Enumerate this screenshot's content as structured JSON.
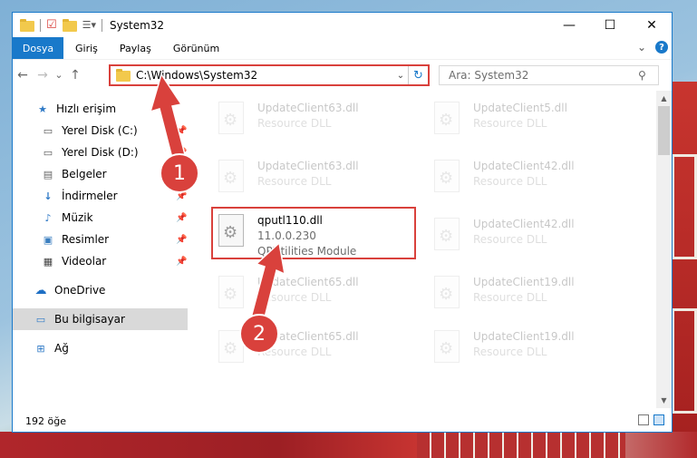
{
  "window": {
    "title": "System32",
    "minimize_glyph": "—",
    "maximize_glyph": "☐",
    "close_glyph": "✕"
  },
  "menu": {
    "file": "Dosya",
    "items": [
      "Giriş",
      "Paylaş",
      "Görünüm"
    ],
    "expand_glyph": "⌄",
    "help_glyph": "?"
  },
  "nav": {
    "back": "←",
    "forward": "→",
    "recent": "⌄",
    "up": "↑",
    "address": "C:\\Windows\\System32",
    "search_placeholder": "Ara: System32"
  },
  "sidebar": {
    "items": [
      {
        "label": "Hızlı erişim",
        "icon": "star-icon",
        "pinned": false
      },
      {
        "label": "Yerel Disk (C:)",
        "icon": "drive-icon",
        "pinned": true
      },
      {
        "label": "Yerel Disk (D:)",
        "icon": "drive-icon",
        "pinned": true
      },
      {
        "label": "Belgeler",
        "icon": "document-icon",
        "pinned": true
      },
      {
        "label": "İndirmeler",
        "icon": "download-icon",
        "pinned": true
      },
      {
        "label": "Müzik",
        "icon": "music-icon",
        "pinned": true
      },
      {
        "label": "Resimler",
        "icon": "picture-icon",
        "pinned": true
      },
      {
        "label": "Videolar",
        "icon": "video-icon",
        "pinned": true
      },
      {
        "label": "OneDrive",
        "icon": "cloud-icon",
        "pinned": false
      },
      {
        "label": "Bu bilgisayar",
        "icon": "computer-icon",
        "pinned": false
      },
      {
        "label": "Ağ",
        "icon": "network-icon",
        "pinned": false
      }
    ]
  },
  "files": [
    {
      "name": "UpdateClient63.dll",
      "line2": "Resource DLL",
      "line3": ""
    },
    {
      "name": "UpdateClient5.dll",
      "line2": "Resource DLL",
      "line3": ""
    },
    {
      "name": "UpdateClient63.dll",
      "line2": "Resource DLL",
      "line3": ""
    },
    {
      "name": "UpdateClient42.dll",
      "line2": "Resource DLL",
      "line3": ""
    },
    {
      "name": "qputl110.dll",
      "line2": "11.0.0.230",
      "line3": "QPUtilities Module"
    },
    {
      "name": "UpdateClient42.dll",
      "line2": "Resource DLL",
      "line3": ""
    },
    {
      "name": "UpdateClient65.dll",
      "line2": "Resource DLL",
      "line3": ""
    },
    {
      "name": "UpdateClient19.dll",
      "line2": "Resource DLL",
      "line3": ""
    },
    {
      "name": "UpdateClient65.dll",
      "line2": "Resource DLL",
      "line3": ""
    },
    {
      "name": "UpdateClient19.dll",
      "line2": "Resource DLL",
      "line3": ""
    }
  ],
  "status": {
    "count": "192 öğe"
  },
  "annotations": {
    "badge1": "1",
    "badge2": "2",
    "color": "#d9413c"
  }
}
